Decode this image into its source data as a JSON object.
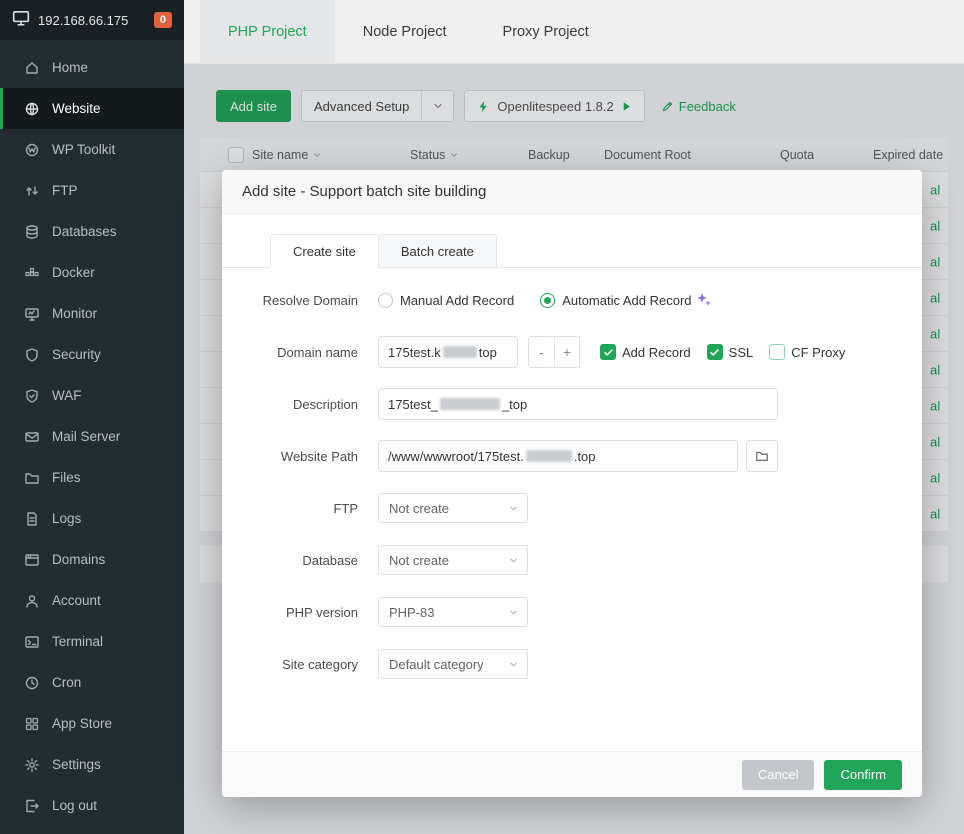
{
  "colors": {
    "accent_green": "#21a558",
    "badge_orange": "#e2623b",
    "sparkle_purple": "#7c6cf0"
  },
  "sidebar": {
    "server_ip": "192.168.66.175",
    "badge": "0",
    "items": [
      {
        "label": "Home",
        "icon": "home-icon"
      },
      {
        "label": "Website",
        "icon": "globe-icon",
        "active": true
      },
      {
        "label": "WP Toolkit",
        "icon": "wordpress-icon"
      },
      {
        "label": "FTP",
        "icon": "ftp-transfer-icon"
      },
      {
        "label": "Databases",
        "icon": "database-icon"
      },
      {
        "label": "Docker",
        "icon": "docker-icon"
      },
      {
        "label": "Monitor",
        "icon": "monitor-icon"
      },
      {
        "label": "Security",
        "icon": "shield-icon"
      },
      {
        "label": "WAF",
        "icon": "waf-shield-icon"
      },
      {
        "label": "Mail Server",
        "icon": "mail-icon"
      },
      {
        "label": "Files",
        "icon": "folder-icon"
      },
      {
        "label": "Logs",
        "icon": "log-file-icon"
      },
      {
        "label": "Domains",
        "icon": "domains-icon"
      },
      {
        "label": "Account",
        "icon": "user-icon"
      },
      {
        "label": "Terminal",
        "icon": "terminal-icon"
      },
      {
        "label": "Cron",
        "icon": "clock-icon"
      },
      {
        "label": "App Store",
        "icon": "app-store-icon"
      },
      {
        "label": "Settings",
        "icon": "gear-icon"
      },
      {
        "label": "Log out",
        "icon": "logout-icon"
      }
    ]
  },
  "tabs": [
    {
      "label": "PHP Project",
      "active": true
    },
    {
      "label": "Node Project"
    },
    {
      "label": "Proxy Project"
    }
  ],
  "toolbar": {
    "add_site": "Add site",
    "advanced_setup": "Advanced Setup",
    "openlitespeed": "Openlitespeed 1.8.2",
    "feedback": "Feedback"
  },
  "table": {
    "headers": [
      "Site name",
      "Status",
      "Backup",
      "Document Root",
      "Quota",
      "Expired date"
    ],
    "row_fragments": [
      "al",
      "al",
      "al",
      "al",
      "al",
      "al",
      "al",
      "al",
      "al",
      "al"
    ]
  },
  "modal": {
    "title": "Add site - Support batch site building",
    "tabs": [
      {
        "label": "Create site",
        "active": true
      },
      {
        "label": "Batch create"
      }
    ],
    "form": {
      "resolve_domain": {
        "label": "Resolve Domain",
        "options": [
          {
            "label": "Manual Add Record",
            "selected": false
          },
          {
            "label": "Automatic Add Record",
            "selected": true
          }
        ]
      },
      "domain": {
        "label": "Domain name",
        "value_prefix": "175test.k",
        "value_suffix": "top",
        "stepper_minus": "-",
        "stepper_plus": "+",
        "checkboxes": [
          {
            "label": "Add Record",
            "checked": true
          },
          {
            "label": "SSL",
            "checked": true
          },
          {
            "label": "CF Proxy",
            "checked": false
          }
        ]
      },
      "description": {
        "label": "Description",
        "value_prefix": "175test_",
        "value_suffix": "_top"
      },
      "website_path": {
        "label": "Website Path",
        "value_prefix": "/www/wwwroot/175test.",
        "value_suffix": ".top"
      },
      "ftp": {
        "label": "FTP",
        "value": "Not create"
      },
      "database": {
        "label": "Database",
        "value": "Not create"
      },
      "php_version": {
        "label": "PHP version",
        "value": "PHP-83"
      },
      "site_category": {
        "label": "Site category",
        "value": "Default category"
      }
    },
    "footer": {
      "cancel": "Cancel",
      "confirm": "Confirm"
    }
  }
}
